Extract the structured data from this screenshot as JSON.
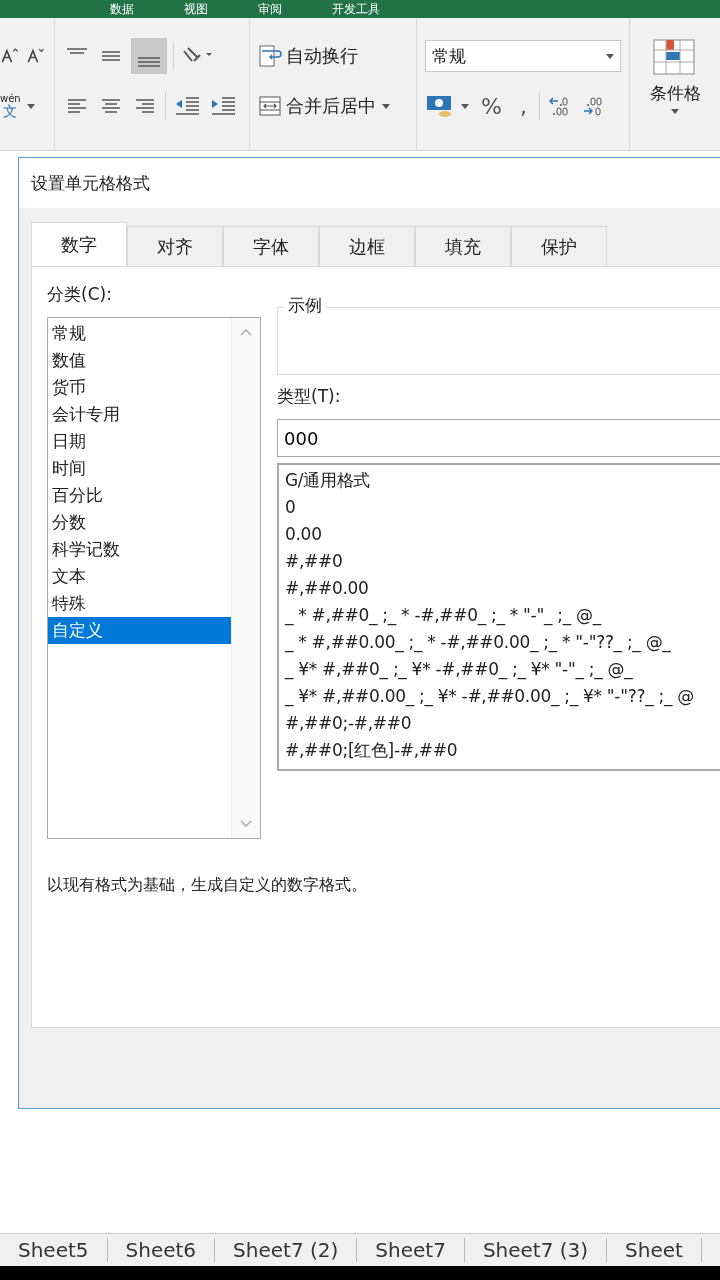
{
  "ribbon_tabs": [
    "数据",
    "视图",
    "审阅",
    "开发工具"
  ],
  "ribbon": {
    "wrap_text": "自动换行",
    "merge_center": "合并后居中",
    "number_format": "常规",
    "percent": "%",
    "comma": ",",
    "conditional_format": "条件格",
    "phonetic": "wén",
    "phonetic_char": "文"
  },
  "dialog": {
    "title": "设置单元格格式",
    "tabs": [
      {
        "label": "数字",
        "selected": true
      },
      {
        "label": "对齐",
        "selected": false
      },
      {
        "label": "字体",
        "selected": false
      },
      {
        "label": "边框",
        "selected": false
      },
      {
        "label": "填充",
        "selected": false
      },
      {
        "label": "保护",
        "selected": false
      }
    ],
    "category_label": "分类(C):",
    "categories": [
      {
        "label": "常规",
        "selected": false
      },
      {
        "label": "数值",
        "selected": false
      },
      {
        "label": "货币",
        "selected": false
      },
      {
        "label": "会计专用",
        "selected": false
      },
      {
        "label": "日期",
        "selected": false
      },
      {
        "label": "时间",
        "selected": false
      },
      {
        "label": "百分比",
        "selected": false
      },
      {
        "label": "分数",
        "selected": false
      },
      {
        "label": "科学记数",
        "selected": false
      },
      {
        "label": "文本",
        "selected": false
      },
      {
        "label": "特殊",
        "selected": false
      },
      {
        "label": "自定义",
        "selected": true
      }
    ],
    "sample_label": "示例",
    "type_label": "类型(T):",
    "type_value": "000",
    "formats": [
      "G/通用格式",
      "0",
      "0.00",
      "#,##0",
      "#,##0.00",
      "_ * #,##0_ ;_ * -#,##0_ ;_ * \"-\"_ ;_ @_",
      "_ * #,##0.00_ ;_ * -#,##0.00_ ;_ * \"-\"??_ ;_ @_",
      "_ ¥* #,##0_ ;_ ¥* -#,##0_ ;_ ¥* \"-\"_ ;_ @_",
      "_ ¥* #,##0.00_ ;_ ¥* -#,##0.00_ ;_ ¥* \"-\"??_ ;_ @",
      "#,##0;-#,##0",
      "#,##0;[红色]-#,##0"
    ],
    "description": "以现有格式为基础，生成自定义的数字格式。"
  },
  "sheet_tabs": [
    "Sheet5",
    "Sheet6",
    "Sheet7 (2)",
    "Sheet7",
    "Sheet7 (3)",
    "Sheet"
  ]
}
